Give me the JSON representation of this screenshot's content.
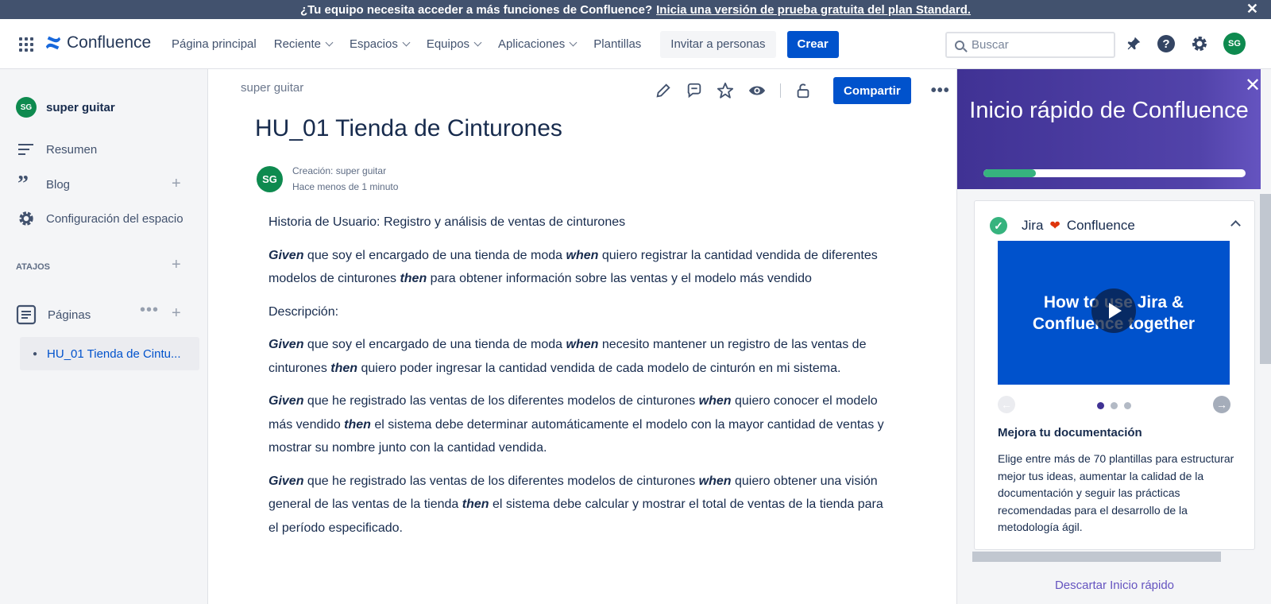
{
  "banner": {
    "text": "¿Tu equipo necesita acceder a más funciones de Confluence?",
    "link": "Inicia una versión de prueba gratuita del plan Standard.",
    "close": "✕"
  },
  "topnav": {
    "logo": "Confluence",
    "items": [
      "Página principal",
      "Reciente",
      "Espacios",
      "Equipos",
      "Aplicaciones",
      "Plantillas"
    ],
    "invite": "Invitar a personas",
    "create": "Crear",
    "search_placeholder": "Buscar",
    "avatar": "SG"
  },
  "sidebar": {
    "space_avatar": "SG",
    "space_name": "super guitar",
    "summary": "Resumen",
    "blog": "Blog",
    "settings": "Configuración del espacio",
    "shortcuts": "ATAJOS",
    "pages": "Páginas",
    "page": "HU_01 Tienda de Cintu..."
  },
  "main": {
    "breadcrumb": "super guitar",
    "share": "Compartir",
    "title": "HU_01 Tienda de Cinturones",
    "byline_avatar": "SG",
    "byline_author": "Creación: super guitar",
    "byline_time": "Hace menos de 1 minuto",
    "heading": "Historia de Usuario: Registro y análisis de ventas de cinturones",
    "description": "Descripción:",
    "paragraphs": [
      {
        "given": "Given",
        "t1": " que soy el encargado de una tienda de moda ",
        "when": "when",
        "t2": " quiero registrar la cantidad vendida de diferentes modelos de cinturones ",
        "then": "then",
        "t3": " para obtener información sobre las ventas y el modelo más vendido"
      },
      {
        "given": "Given",
        "t1": " que soy el encargado de una tienda de moda ",
        "when": "when",
        "t2": " necesito mantener un registro de las ventas de cinturones ",
        "then": "then",
        "t3": " quiero poder ingresar la cantidad vendida de cada modelo de cinturón en mi sistema."
      },
      {
        "given": "Given",
        "t1": " que he registrado las ventas de los diferentes modelos de cinturones ",
        "when": "when",
        "t2": " quiero conocer el modelo más vendido ",
        "then": "then",
        "t3": " el sistema debe determinar automáticamente el modelo con la mayor cantidad de ventas y mostrar su nombre junto con la cantidad vendida."
      },
      {
        "given": "Given",
        "t1": " que he registrado las ventas de los diferentes modelos de cinturones ",
        "when": "when",
        "t2": " quiero obtener una visión general de las ventas de la tienda ",
        "then": "then",
        "t3": " el sistema debe calcular y mostrar el total de ventas de la tienda para el período especificado."
      }
    ]
  },
  "quickstart": {
    "title": "Inicio rápido de Confluence",
    "progress": 0.2,
    "card_title_left": "Jira",
    "card_title_right": "Confluence",
    "video_text": "How to use Jira & Confluence together",
    "subtitle": "Mejora tu documentación",
    "description": "Elige entre más de 70 plantillas para estructurar mejor tus ideas, aumentar la calidad de la documentación y seguir las prácticas recomendadas para el desarrollo de la metodología ágil.",
    "dismiss": "Descartar Inicio rápido"
  },
  "colors": {
    "primary": "#0052cc",
    "avatar": "#0e8a4f",
    "quickstart": "#5243aa"
  }
}
